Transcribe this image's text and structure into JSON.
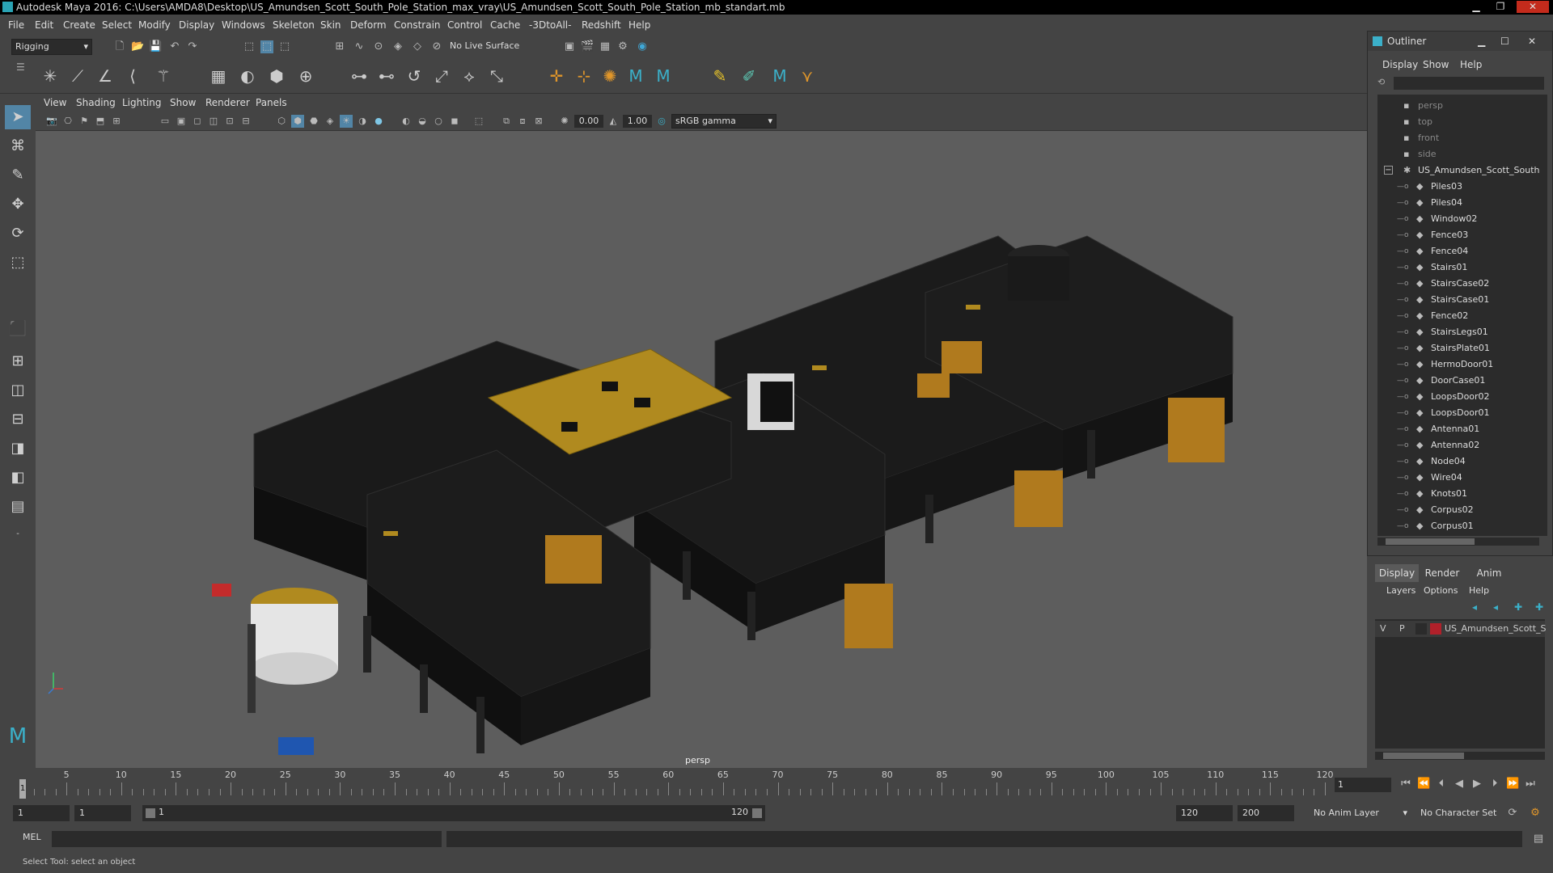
{
  "window": {
    "title": "Autodesk Maya 2016: C:\\Users\\AMDA8\\Desktop\\US_Amundsen_Scott_South_Pole_Station_max_vray\\US_Amundsen_Scott_South_Pole_Station_mb_standart.mb",
    "minimize": "▁",
    "restore": "❐",
    "close": "✕"
  },
  "menubar": [
    "File",
    "Edit",
    "Create",
    "Select",
    "Modify",
    "Display",
    "Windows",
    "Skeleton",
    "Skin",
    "Deform",
    "Constrain",
    "Control",
    "Cache",
    "-3DtoAll-",
    "Redshift",
    "Help"
  ],
  "toolbar": {
    "mode": "Rigging",
    "live_surface": "No Live Surface"
  },
  "panel": {
    "menus": [
      "View",
      "Shading",
      "Lighting",
      "Show",
      "Renderer",
      "Panels"
    ],
    "exposure": "0.00",
    "gamma": "1.00",
    "color_space": "sRGB gamma",
    "camera": "persp"
  },
  "outliner": {
    "title": "Outliner",
    "menus": [
      "Display",
      "Show",
      "Help"
    ],
    "items": [
      {
        "label": "persp",
        "type": "camera",
        "dim": true
      },
      {
        "label": "top",
        "type": "camera",
        "dim": true
      },
      {
        "label": "front",
        "type": "camera",
        "dim": true
      },
      {
        "label": "side",
        "type": "camera",
        "dim": true
      },
      {
        "label": "US_Amundsen_Scott_South",
        "type": "group",
        "dim": false
      },
      {
        "label": "Piles03",
        "type": "mesh",
        "dim": false
      },
      {
        "label": "Piles04",
        "type": "mesh",
        "dim": false
      },
      {
        "label": "Window02",
        "type": "mesh",
        "dim": false
      },
      {
        "label": "Fence03",
        "type": "mesh",
        "dim": false
      },
      {
        "label": "Fence04",
        "type": "mesh",
        "dim": false
      },
      {
        "label": "Stairs01",
        "type": "mesh",
        "dim": false
      },
      {
        "label": "StairsCase02",
        "type": "mesh",
        "dim": false
      },
      {
        "label": "StairsCase01",
        "type": "mesh",
        "dim": false
      },
      {
        "label": "Fence02",
        "type": "mesh",
        "dim": false
      },
      {
        "label": "StairsLegs01",
        "type": "mesh",
        "dim": false
      },
      {
        "label": "StairsPlate01",
        "type": "mesh",
        "dim": false
      },
      {
        "label": "HermoDoor01",
        "type": "mesh",
        "dim": false
      },
      {
        "label": "DoorCase01",
        "type": "mesh",
        "dim": false
      },
      {
        "label": "LoopsDoor02",
        "type": "mesh",
        "dim": false
      },
      {
        "label": "LoopsDoor01",
        "type": "mesh",
        "dim": false
      },
      {
        "label": "Antenna01",
        "type": "mesh",
        "dim": false
      },
      {
        "label": "Antenna02",
        "type": "mesh",
        "dim": false
      },
      {
        "label": "Node04",
        "type": "mesh",
        "dim": false
      },
      {
        "label": "Wire04",
        "type": "mesh",
        "dim": false
      },
      {
        "label": "Knots01",
        "type": "mesh",
        "dim": false
      },
      {
        "label": "Corpus02",
        "type": "mesh",
        "dim": false
      },
      {
        "label": "Corpus01",
        "type": "mesh",
        "dim": false
      }
    ]
  },
  "layer_editor": {
    "tabs": [
      "Display",
      "Render",
      "Anim"
    ],
    "menus": [
      "Layers",
      "Options",
      "Help"
    ],
    "layer": {
      "v": "V",
      "p": "P",
      "name": "US_Amundsen_Scott_S",
      "color": "#b0202a"
    }
  },
  "timeline": {
    "ticks": [
      1,
      5,
      10,
      15,
      20,
      25,
      30,
      35,
      40,
      45,
      50,
      55,
      60,
      65,
      70,
      75,
      80,
      85,
      90,
      95,
      100,
      105,
      110,
      115,
      120
    ],
    "current_frame": "1"
  },
  "range": {
    "start": "1",
    "playback_start": "1",
    "slider_start": "1",
    "slider_end": "120",
    "playback_end": "120",
    "end": "200",
    "anim_layer": "No Anim Layer",
    "character_set": "No Character Set"
  },
  "cmdline": {
    "label": "MEL"
  },
  "helpline": {
    "text": "Select Tool: select an object"
  }
}
